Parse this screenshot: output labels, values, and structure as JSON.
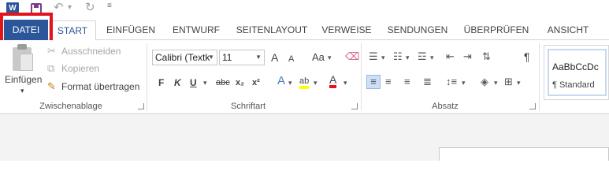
{
  "qat": {
    "app_icon_text": "W",
    "undo_glyph": "↶",
    "undo_drop_glyph": "▾",
    "redo_glyph": "↻",
    "customize_glyph": "≡"
  },
  "tabs": [
    {
      "label": "DATEI",
      "name": "tab-datei"
    },
    {
      "label": "START",
      "name": "tab-start"
    },
    {
      "label": "EINFÜGEN",
      "name": "tab-einfuegen"
    },
    {
      "label": "ENTWURF",
      "name": "tab-entwurf"
    },
    {
      "label": "SEITENLAYOUT",
      "name": "tab-seitenlayout"
    },
    {
      "label": "VERWEISE",
      "name": "tab-verweise"
    },
    {
      "label": "SENDUNGEN",
      "name": "tab-sendungen"
    },
    {
      "label": "ÜBERPRÜFEN",
      "name": "tab-ueberpruefen"
    },
    {
      "label": "ANSICHT",
      "name": "tab-ansicht"
    }
  ],
  "clipboard": {
    "paste_label": "Einfügen",
    "paste_drop": "▾",
    "cut_label": "Ausschneiden",
    "copy_label": "Kopieren",
    "format_label": "Format übertragen",
    "group_label": "Zwischenablage"
  },
  "font": {
    "font_name": "Calibri (Textk",
    "font_size": "11",
    "grow_label": "A",
    "shrink_label": "A",
    "case_label": "Aa",
    "bold": "F",
    "italic": "K",
    "underline": "U",
    "strike": "abc",
    "subscript": "x₂",
    "superscript": "x²",
    "effects": "A",
    "highlight": "ab",
    "color": "A",
    "group_label": "Schriftart"
  },
  "paragraph": {
    "group_label": "Absatz",
    "show_marks": "¶"
  },
  "styles": {
    "sample": "AaBbCcDc",
    "name": "¶ Standard"
  },
  "colors": {
    "brand": "#2b579a",
    "highlight_outline": "#e4141b",
    "font_red": "#e4141b",
    "highlight_yellow": "#ffff00"
  }
}
